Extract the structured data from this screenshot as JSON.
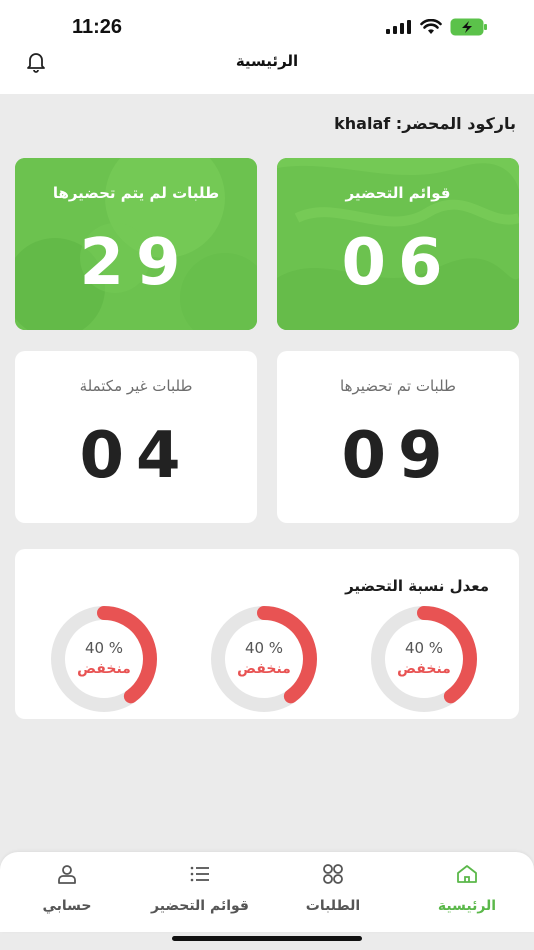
{
  "status_bar": {
    "time": "11:26"
  },
  "header": {
    "title": "الرئيسية",
    "bell_icon": "bell-icon"
  },
  "barcode": {
    "text": "باركود المحضر: khalaf"
  },
  "cards": {
    "prep_lists": {
      "label": "قوائم التحضير",
      "value": "06"
    },
    "unprepared_orders": {
      "label": "طلبات لم يتم تحضيرها",
      "value": "29"
    },
    "prepared_orders": {
      "label": "طلبات تم تحضيرها",
      "value": "09"
    },
    "incomplete_orders": {
      "label": "طلبات غير مكتملة",
      "value": "04"
    }
  },
  "rate": {
    "title": "معدل نسبة التحضير",
    "gauges": [
      {
        "value": "40 %",
        "percent": 40,
        "status": "منخفض"
      },
      {
        "value": "40 %",
        "percent": 40,
        "status": "منخفض"
      },
      {
        "value": "40 %",
        "percent": 40,
        "status": "منخفض"
      }
    ],
    "track_color": "#e6e6e6",
    "fill_color": "#e85353"
  },
  "nav": {
    "home": {
      "label": "الرئيسية",
      "icon": "home-icon"
    },
    "orders": {
      "label": "الطلبات",
      "icon": "grid-circles-icon"
    },
    "prep_lists": {
      "label": "قوائم التحضير",
      "icon": "list-icon"
    },
    "account": {
      "label": "حسابي",
      "icon": "user-icon"
    }
  },
  "colors": {
    "accent": "#5bb84a",
    "card_green": "#6cc24f"
  }
}
